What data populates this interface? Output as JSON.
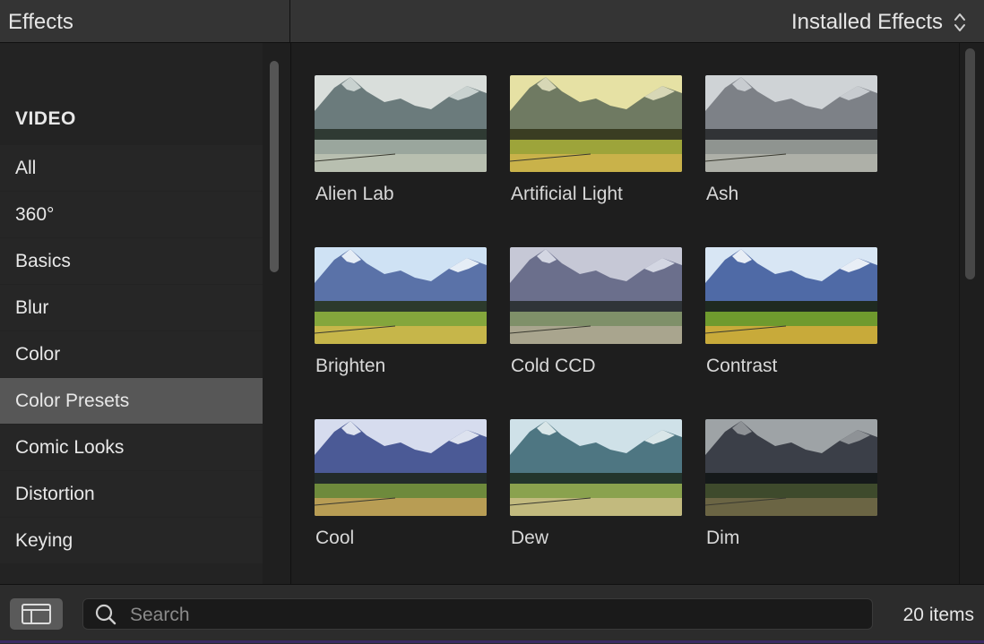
{
  "header": {
    "title": "Effects",
    "filter_label": "Installed Effects",
    "filter_icon": "updown-chevron-icon"
  },
  "sidebar": {
    "heading": "VIDEO",
    "items": [
      {
        "label": "All",
        "selected": false
      },
      {
        "label": "360°",
        "selected": false
      },
      {
        "label": "Basics",
        "selected": false
      },
      {
        "label": "Blur",
        "selected": false
      },
      {
        "label": "Color",
        "selected": false
      },
      {
        "label": "Color Presets",
        "selected": true
      },
      {
        "label": "Comic Looks",
        "selected": false
      },
      {
        "label": "Distortion",
        "selected": false
      },
      {
        "label": "Keying",
        "selected": false
      }
    ]
  },
  "effects": [
    {
      "name": "Alien Lab",
      "sky": "#d9dedb",
      "mtn": "#6b7b7c",
      "snow": "#c9d2d0",
      "trees": "#2f3a33",
      "field": "#9aa69d",
      "grass": "#b8bfb0"
    },
    {
      "name": "Artificial Light",
      "sky": "#e6e1a4",
      "mtn": "#6f7a62",
      "snow": "#d7d7b6",
      "trees": "#3a3d22",
      "field": "#9da43a",
      "grass": "#c9b24a"
    },
    {
      "name": "Ash",
      "sky": "#cfd3d6",
      "mtn": "#7d8187",
      "snow": "#c8ccd0",
      "trees": "#313336",
      "field": "#8f9490",
      "grass": "#aeb0a8"
    },
    {
      "name": "Brighten",
      "sky": "#cfe2f4",
      "mtn": "#5a72a8",
      "snow": "#e5edf6",
      "trees": "#2c3a2c",
      "field": "#84a63c",
      "grass": "#c6b64a"
    },
    {
      "name": "Cold CCD",
      "sky": "#c6c8d6",
      "mtn": "#6b6f8c",
      "snow": "#d3d6e2",
      "trees": "#2f3438",
      "field": "#7f9069",
      "grass": "#a9a58e"
    },
    {
      "name": "Contrast",
      "sky": "#d8e6f4",
      "mtn": "#4f6aa6",
      "snow": "#e8eef6",
      "trees": "#1f2a20",
      "field": "#6f9a2e",
      "grass": "#c8aa3a"
    },
    {
      "name": "Cool",
      "sky": "#d6dcee",
      "mtn": "#4b5a96",
      "snow": "#dde2ef",
      "trees": "#232b2a",
      "field": "#6e8a3c",
      "grass": "#b89d54"
    },
    {
      "name": "Dew",
      "sky": "#cfe1e8",
      "mtn": "#4e7682",
      "snow": "#d9e6e8",
      "trees": "#23352c",
      "field": "#8aa24e",
      "grass": "#c2ba7e"
    },
    {
      "name": "Dim",
      "sky": "#9ea3a6",
      "mtn": "#3b3f48",
      "snow": "#8e9296",
      "trees": "#15191a",
      "field": "#3e4a2c",
      "grass": "#6b6544"
    }
  ],
  "footer": {
    "layout_icon": "browser-layout-icon",
    "search_icon": "search-icon",
    "search_placeholder": "Search",
    "search_value": "",
    "item_count": "20 items"
  }
}
